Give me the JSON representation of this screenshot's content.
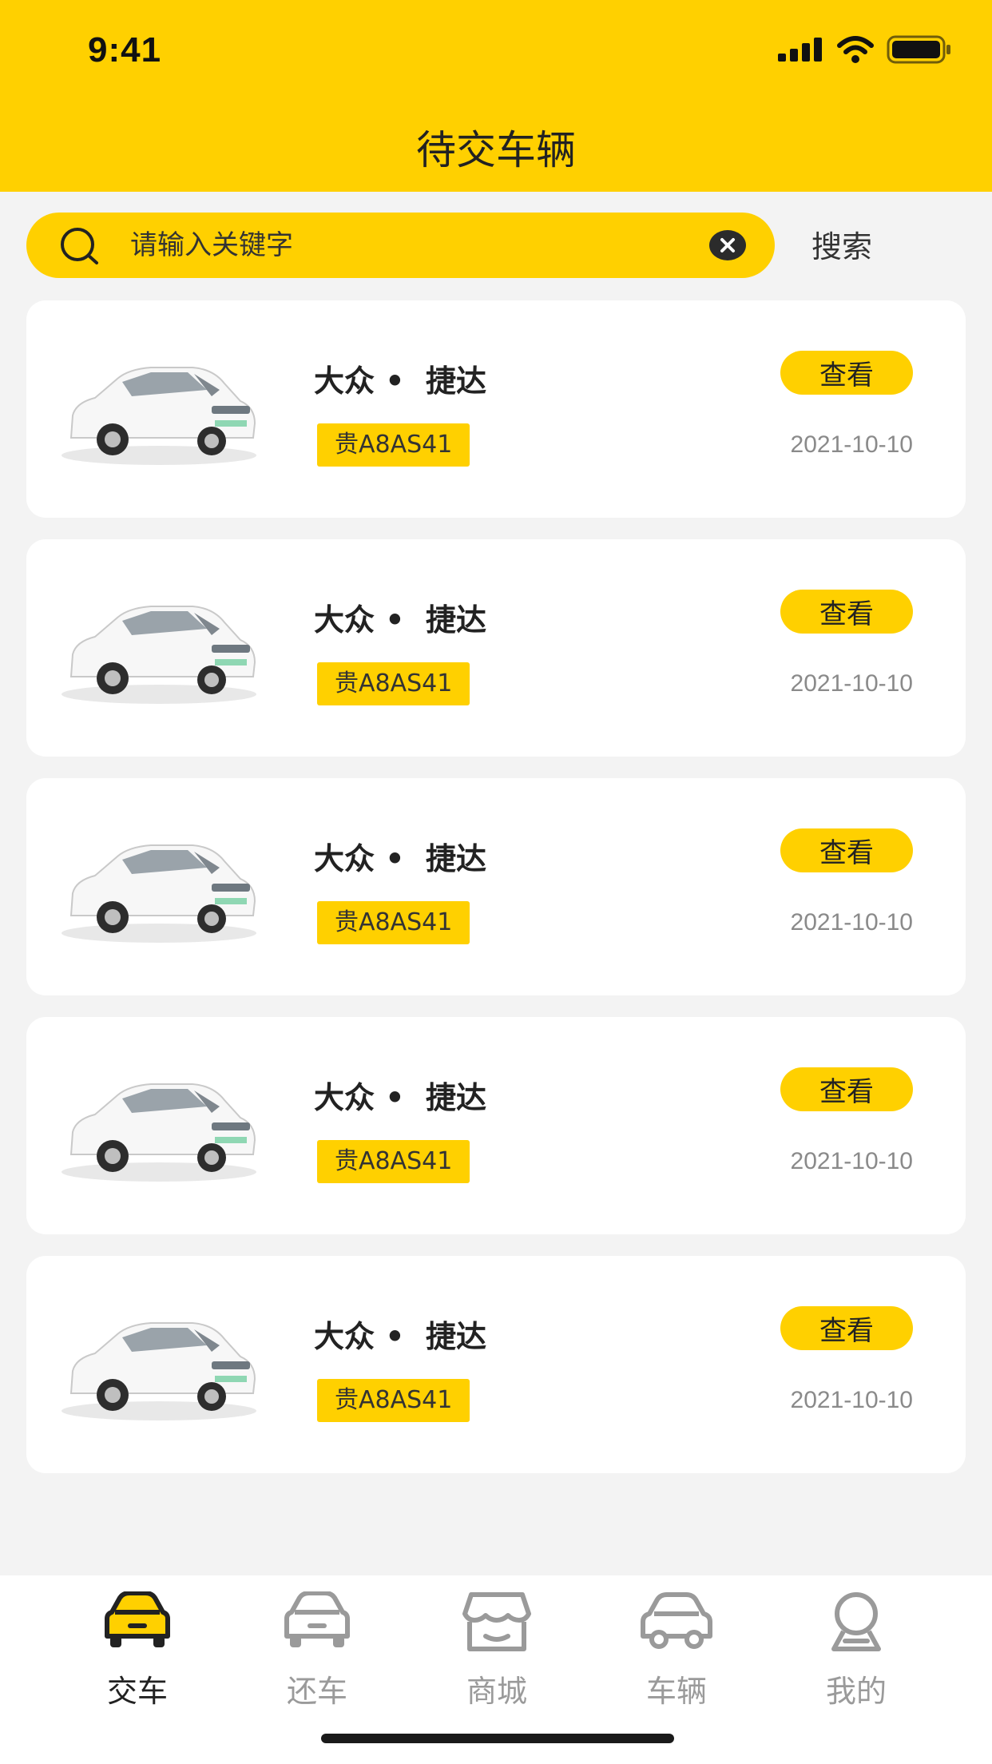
{
  "status_bar": {
    "time": "9:41"
  },
  "header": {
    "title": "待交车辆"
  },
  "search": {
    "placeholder": "请输入关键字",
    "button_label": "搜索"
  },
  "colors": {
    "accent": "#FFD000",
    "text": "#222222",
    "muted": "#8A8A8A"
  },
  "vehicles": [
    {
      "name": "大众 •  捷达",
      "plate": "贵A8AS41",
      "date": "2021-10-10",
      "action": "查看"
    },
    {
      "name": "大众 •  捷达",
      "plate": "贵A8AS41",
      "date": "2021-10-10",
      "action": "查看"
    },
    {
      "name": "大众 •  捷达",
      "plate": "贵A8AS41",
      "date": "2021-10-10",
      "action": "查看"
    },
    {
      "name": "大众 •  捷达",
      "plate": "贵A8AS41",
      "date": "2021-10-10",
      "action": "查看"
    },
    {
      "name": "大众 •  捷达",
      "plate": "贵A8AS41",
      "date": "2021-10-10",
      "action": "查看"
    }
  ],
  "tabs": [
    {
      "label": "交车",
      "icon": "car-front-icon",
      "active": true
    },
    {
      "label": "还车",
      "icon": "car-front-icon",
      "active": false
    },
    {
      "label": "商城",
      "icon": "store-icon",
      "active": false
    },
    {
      "label": "车辆",
      "icon": "car-icon",
      "active": false
    },
    {
      "label": "我的",
      "icon": "profile-icon",
      "active": false
    }
  ]
}
